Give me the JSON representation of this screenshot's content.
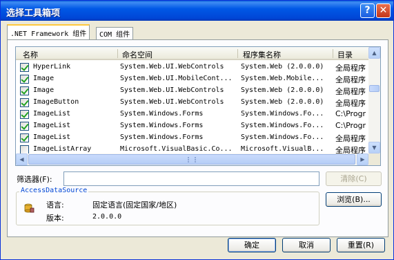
{
  "window": {
    "title": "选择工具箱项"
  },
  "titlebar_buttons": {
    "help": "?",
    "close": "✕"
  },
  "tabs": [
    {
      "label": ".NET Framework 组件",
      "selected": true
    },
    {
      "label": "COM 组件",
      "selected": false
    }
  ],
  "list": {
    "columns": [
      "名称",
      "命名空间",
      "程序集名称",
      "目录"
    ],
    "rows": [
      {
        "checked": true,
        "name": "HyperLink",
        "namespace": "System.Web.UI.WebControls",
        "assembly": "System.Web (2.0.0.0)",
        "dir": "全局程序"
      },
      {
        "checked": true,
        "name": "Image",
        "namespace": "System.Web.UI.MobileCont...",
        "assembly": "System.Web.Mobile...",
        "dir": "全局程序"
      },
      {
        "checked": true,
        "name": "Image",
        "namespace": "System.Web.UI.WebControls",
        "assembly": "System.Web (2.0.0.0)",
        "dir": "全局程序"
      },
      {
        "checked": true,
        "name": "ImageButton",
        "namespace": "System.Web.UI.WebControls",
        "assembly": "System.Web (2.0.0.0)",
        "dir": "全局程序"
      },
      {
        "checked": true,
        "name": "ImageList",
        "namespace": "System.Windows.Forms",
        "assembly": "System.Windows.Fo...",
        "dir": "C:\\Progr"
      },
      {
        "checked": true,
        "name": "ImageList",
        "namespace": "System.Windows.Forms",
        "assembly": "System.Windows.Fo...",
        "dir": "C:\\Progr"
      },
      {
        "checked": true,
        "name": "ImageList",
        "namespace": "System.Windows.Forms",
        "assembly": "System.Windows.Fo...",
        "dir": "全局程序"
      },
      {
        "checked": false,
        "name": "ImageListArray",
        "namespace": "Microsoft.VisualBasic.Co...",
        "assembly": "Microsoft.VisualB...",
        "dir": "全局程序"
      }
    ]
  },
  "scroll": {
    "up": "▲",
    "down": "▼",
    "left": "◀",
    "right": "▶"
  },
  "filter": {
    "label": "筛选器(F):",
    "value": "",
    "clear_label": "清除(C)"
  },
  "details": {
    "legend": "AccessDataSource",
    "language_label": "语言:",
    "language_value": "固定语言(固定国家/地区)",
    "version_label": "版本:",
    "version_value": "2.0.0.0",
    "browse_label": "浏览(B)..."
  },
  "footer": {
    "ok_label": "确定",
    "cancel_label": "取消",
    "reset_label": "重置(R)"
  }
}
